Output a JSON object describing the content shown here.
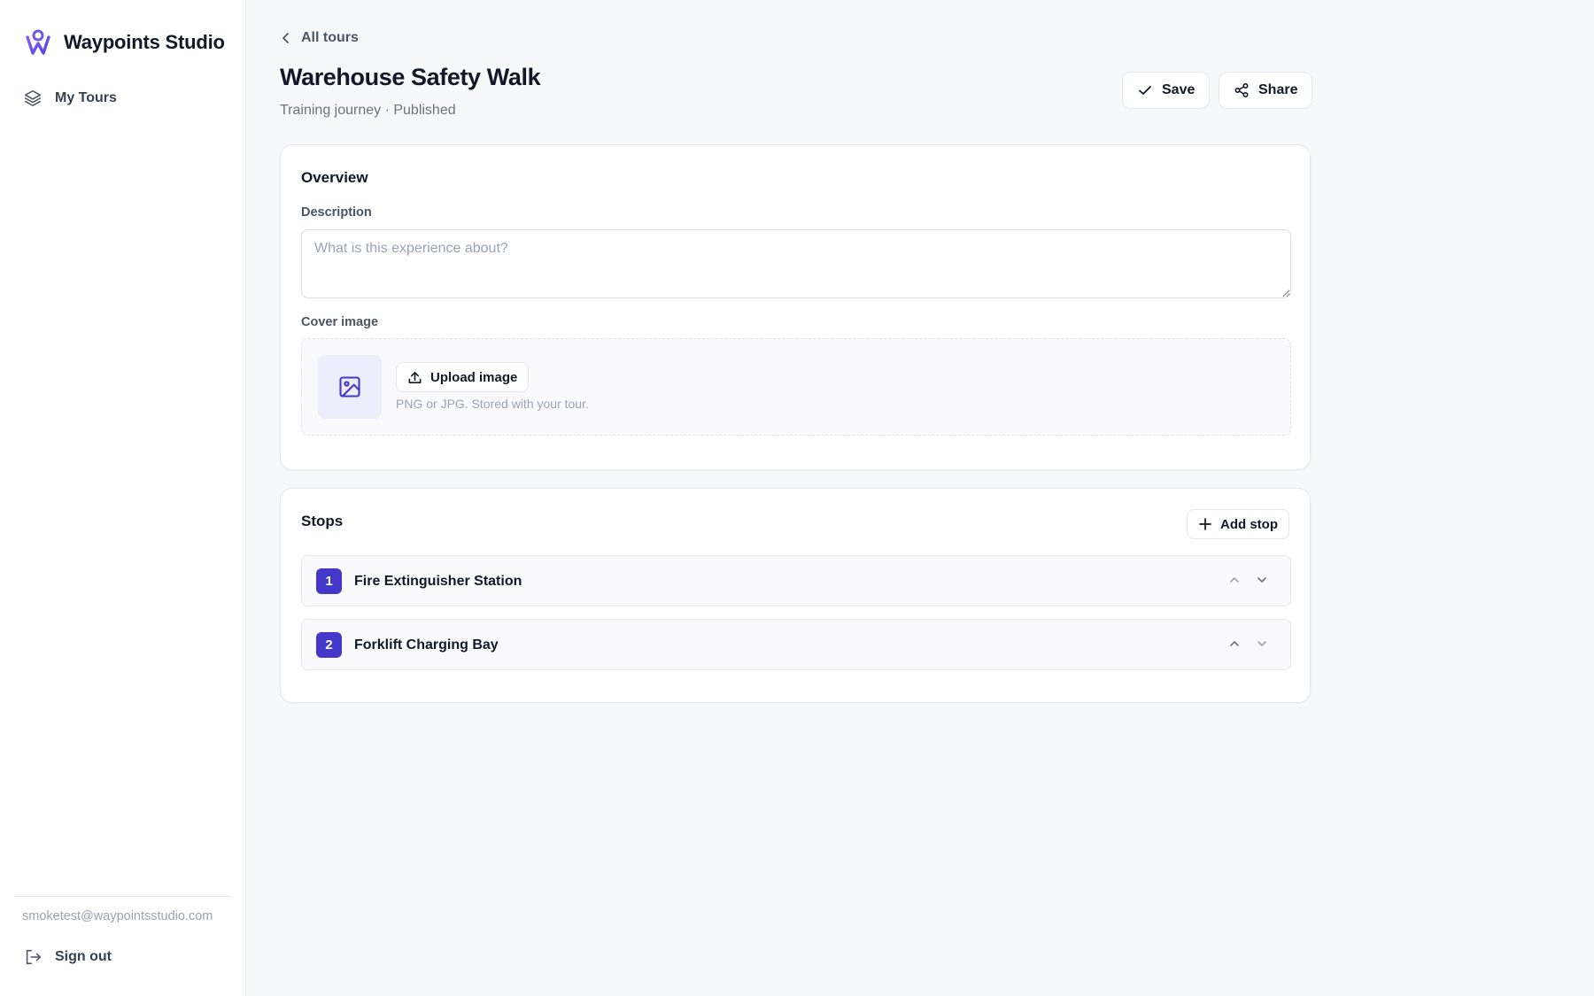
{
  "brand": {
    "name": "Waypoints Studio",
    "logo_icon": "waypoint-logo-icon"
  },
  "sidebar": {
    "items": [
      {
        "label": "My Tours",
        "icon": "layers-icon"
      }
    ],
    "user_email": "smoketest@waypointsstudio.com",
    "signout_label": "Sign out"
  },
  "header": {
    "back_label": "All tours",
    "title": "Warehouse Safety Walk",
    "subtitle": "Training journey · Published",
    "save_label": "Save",
    "share_label": "Share"
  },
  "overview": {
    "title": "Overview",
    "description_label": "Description",
    "description_value": "",
    "description_placeholder": "What is this experience about?",
    "cover_label": "Cover image",
    "upload_label": "Upload image",
    "upload_hint": "PNG or JPG. Stored with your tour."
  },
  "stops": {
    "title": "Stops",
    "add_label": "Add stop",
    "items": [
      {
        "number": "1",
        "name": "Fire Extinguisher Station"
      },
      {
        "number": "2",
        "name": "Forklift Charging Bay"
      }
    ]
  },
  "colors": {
    "accent": "#4338ca",
    "background": "#f7f8fa",
    "thumb_bg": "#eeedfb"
  }
}
